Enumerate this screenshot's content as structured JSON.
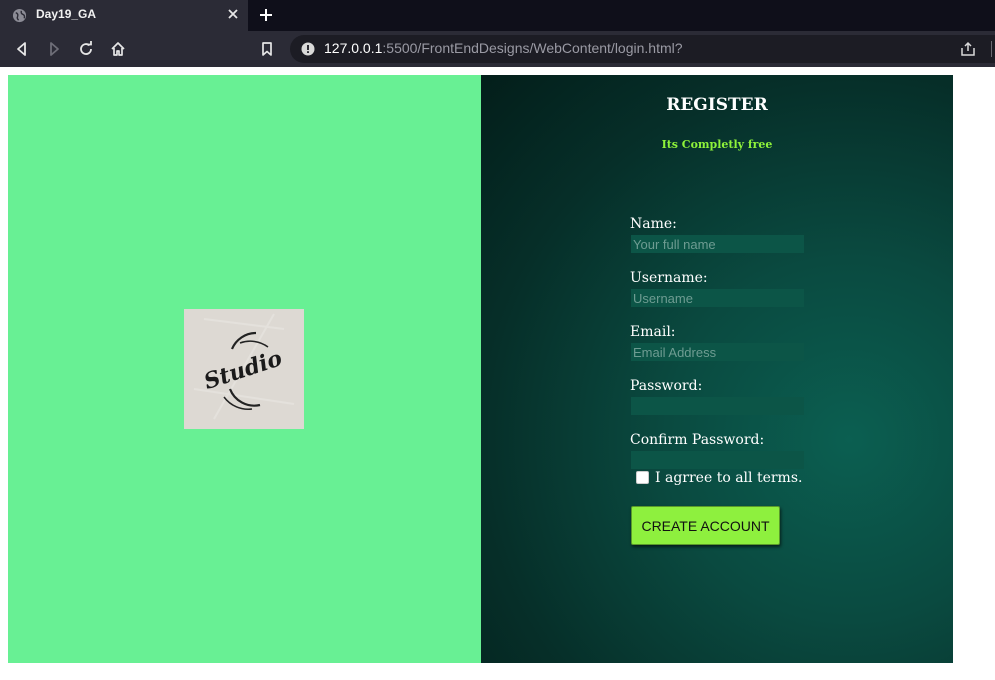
{
  "browser": {
    "tab": {
      "title": "Day19_GA"
    },
    "address": {
      "host": "127.0.0.1",
      "rest": ":5500/FrontEndDesigns/WebContent/login.html?"
    }
  },
  "colors": {
    "left_panel": "#68f094",
    "accent_green": "#8ef33a",
    "button_bg": "#8ef03e"
  },
  "logo": {
    "text": "Studio",
    "icon": "studio-logo"
  },
  "form": {
    "title": "REGISTER",
    "subtitle": "Its Completly free",
    "fields": [
      {
        "label": "Name:",
        "placeholder": "Your full name",
        "value": ""
      },
      {
        "label": "Username:",
        "placeholder": "Username",
        "value": ""
      },
      {
        "label": "Email:",
        "placeholder": "Email Address",
        "value": ""
      },
      {
        "label": "Password:",
        "placeholder": "",
        "value": ""
      },
      {
        "label": "Confirm Password:",
        "placeholder": "",
        "value": ""
      }
    ],
    "agree": {
      "label": "I agrree to all terms.",
      "checked": false
    },
    "submit_label": "CREATE ACCOUNT"
  }
}
